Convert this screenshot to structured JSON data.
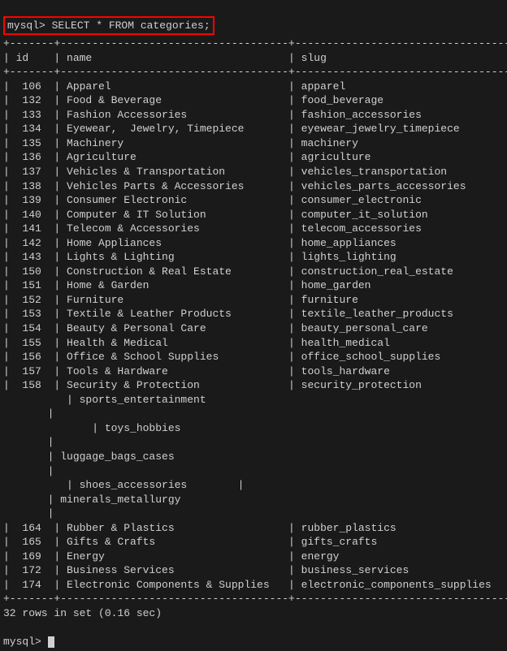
{
  "prompt_cmd": "mysql> SELECT * FROM categories;",
  "columns": [
    "id",
    "name",
    "slug"
  ],
  "rows": [
    {
      "id": "106",
      "name": "Apparel",
      "slug": "apparel"
    },
    {
      "id": "132",
      "name": "Food & Beverage",
      "slug": "food_beverage"
    },
    {
      "id": "133",
      "name": "Fashion Accessories",
      "slug": "fashion_accessories"
    },
    {
      "id": "134",
      "name": "Eyewear,  Jewelry, Timepiece",
      "slug": "eyewear_jewelry_timepiece"
    },
    {
      "id": "135",
      "name": "Machinery",
      "slug": "machinery"
    },
    {
      "id": "136",
      "name": "Agriculture",
      "slug": "agriculture"
    },
    {
      "id": "137",
      "name": "Vehicles & Transportation",
      "slug": "vehicles_transportation"
    },
    {
      "id": "138",
      "name": "Vehicles Parts & Accessories",
      "slug": "vehicles_parts_accessories"
    },
    {
      "id": "139",
      "name": "Consumer Electronic",
      "slug": "consumer_electronic"
    },
    {
      "id": "140",
      "name": "Computer & IT Solution",
      "slug": "computer_it_solution"
    },
    {
      "id": "141",
      "name": "Telecom & Accessories",
      "slug": "telecom_accessories"
    },
    {
      "id": "142",
      "name": "Home Appliances",
      "slug": "home_appliances"
    },
    {
      "id": "143",
      "name": "Lights & Lighting",
      "slug": "lights_lighting"
    },
    {
      "id": "150",
      "name": "Construction & Real Estate",
      "slug": "construction_real_estate"
    },
    {
      "id": "151",
      "name": "Home & Garden",
      "slug": "home_garden"
    },
    {
      "id": "152",
      "name": "Furniture",
      "slug": "furniture"
    },
    {
      "id": "153",
      "name": "Textile & Leather Products",
      "slug": "textile_leather_products"
    },
    {
      "id": "154",
      "name": "Beauty & Personal Care",
      "slug": "beauty_personal_care"
    },
    {
      "id": "155",
      "name": "Health & Medical",
      "slug": "health_medical"
    },
    {
      "id": "156",
      "name": "Office & School Supplies",
      "slug": "office_school_supplies"
    },
    {
      "id": "157",
      "name": "Tools & Hardware",
      "slug": "tools_hardware"
    },
    {
      "id": "158",
      "name": "Security & Protection",
      "slug": "security_protection"
    }
  ],
  "wrapped_lines": [
    "          | sports_entertainment",
    "       |",
    "              | toys_hobbies",
    "       |",
    "       | luggage_bags_cases",
    "       |",
    "          | shoes_accessories        |",
    "       | minerals_metallurgy",
    "       |"
  ],
  "rows2": [
    {
      "id": "164",
      "name": "Rubber & Plastics",
      "slug": "rubber_plastics"
    },
    {
      "id": "165",
      "name": "Gifts & Crafts",
      "slug": "gifts_crafts"
    },
    {
      "id": "169",
      "name": "Energy",
      "slug": "energy"
    },
    {
      "id": "172",
      "name": "Business Services",
      "slug": "business_services"
    },
    {
      "id": "174",
      "name": "Electronic Components & Supplies",
      "slug": "electronic_components_supplies"
    }
  ],
  "footer": "32 rows in set (0.16 sec)",
  "next_prompt": "mysql> ",
  "widths": {
    "id": 5,
    "name": 34,
    "slug": 32
  }
}
